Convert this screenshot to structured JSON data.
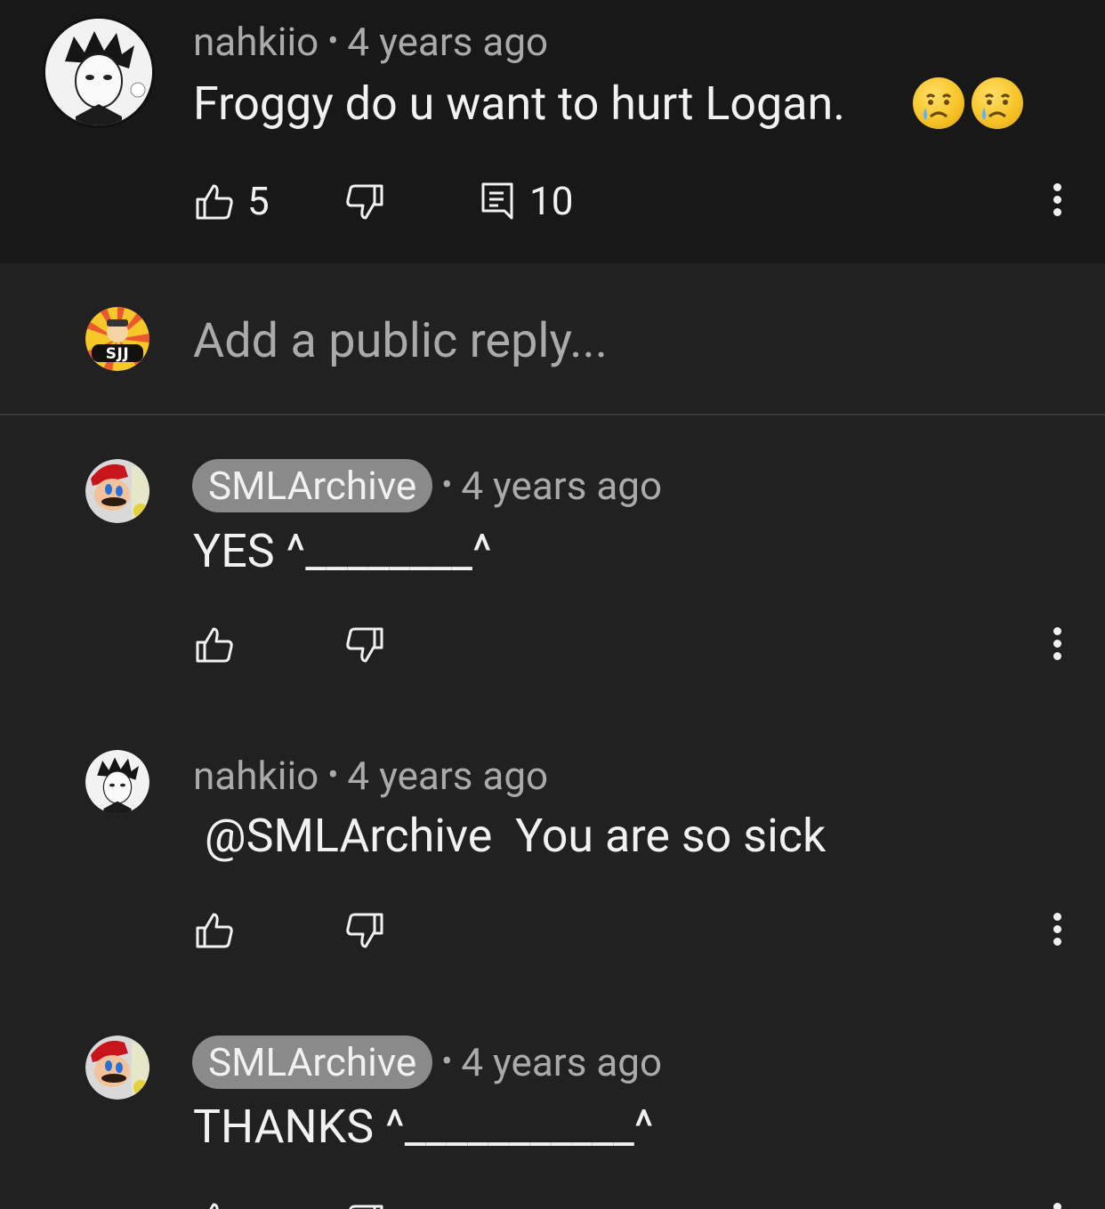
{
  "parent_comment": {
    "author": "nahkiio",
    "time": "4 years ago",
    "separator": "•",
    "text": "Froggy do u want to hurt Logan.",
    "emojis": [
      "crying-face",
      "crying-face"
    ],
    "like_count": "5",
    "reply_count": "10"
  },
  "reply_box": {
    "placeholder": "Add a public reply...",
    "avatar_text": "SJJ"
  },
  "replies": [
    {
      "author": "SMLArchive",
      "is_creator_badge": true,
      "time": "4 years ago",
      "separator": "•",
      "text": "YES ^________^"
    },
    {
      "author": "nahkiio",
      "is_creator_badge": false,
      "time": "4 years ago",
      "separator": "•",
      "text": " @SMLArchive  You are so sick"
    },
    {
      "author": "SMLArchive",
      "is_creator_badge": true,
      "time": "4 years ago",
      "separator": "•",
      "text": "THANKS ^___________^"
    }
  ],
  "colors": {
    "background": "#212121",
    "parent_background": "#181818",
    "text_primary": "#f1f1f1",
    "text_secondary": "#aaaaaa",
    "creator_badge": "#8a8a8a"
  }
}
